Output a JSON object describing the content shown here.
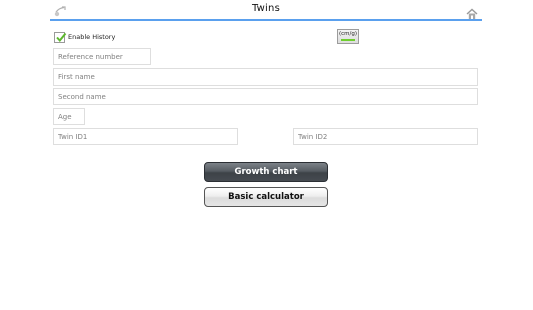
{
  "header": {
    "title": "Twins",
    "accent_color": "#5aa0ee",
    "back_icon": "back-arrow-icon",
    "home_icon": "home-icon"
  },
  "history": {
    "label": "Enable History",
    "checked": true
  },
  "unit_toggle": {
    "label": "(cm/g)",
    "indicator_color": "#6fcf2e"
  },
  "form": {
    "reference_number": {
      "placeholder": "Reference number",
      "value": ""
    },
    "first_name": {
      "placeholder": "First name",
      "value": ""
    },
    "second_name": {
      "placeholder": "Second name",
      "value": ""
    },
    "age": {
      "placeholder": "Age",
      "value": ""
    },
    "twin_id1": {
      "placeholder": "Twin ID1",
      "value": ""
    },
    "twin_id2": {
      "placeholder": "Twin ID2",
      "value": ""
    }
  },
  "actions": {
    "growth_chart": "Growth chart",
    "basic_calculator": "Basic calculator"
  }
}
